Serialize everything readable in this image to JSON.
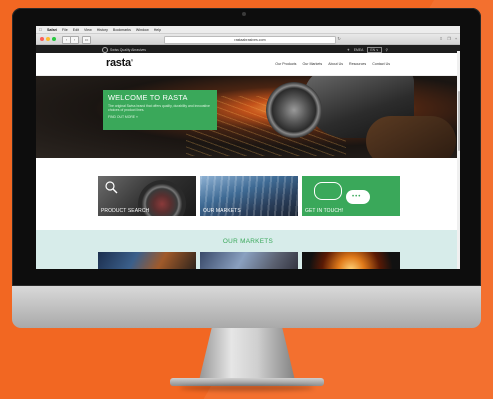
{
  "menubar": {
    "apple_icon": "apple-icon",
    "items": [
      "Safari",
      "File",
      "Edit",
      "View",
      "History",
      "Bookmarks",
      "Window",
      "Help"
    ]
  },
  "browser": {
    "url": "rastaabrasives.com"
  },
  "topbar": {
    "badge_text": "Swiss Quality Abrasives",
    "phone_text": "EMEA",
    "lang": "EN ∨"
  },
  "header": {
    "logo": "rasta",
    "nav": [
      "Our Products",
      "Our Markets",
      "About Us",
      "Resources",
      "Contact Us"
    ]
  },
  "hero": {
    "title": "WELCOME TO RASTA",
    "text": "The original Swiss brand that offers quality, durability and innovative choices of product lines.",
    "link": "FIND OUT MORE »"
  },
  "tiles": [
    {
      "label": "PRODUCT SEARCH"
    },
    {
      "label": "OUR MARKETS"
    },
    {
      "label": "GET IN TOUCH!"
    }
  ],
  "markets": {
    "title": "OUR MARKETS"
  },
  "colors": {
    "background": "#f26722",
    "accent_green": "#3aa85a",
    "markets_bg": "#d7ecea"
  }
}
